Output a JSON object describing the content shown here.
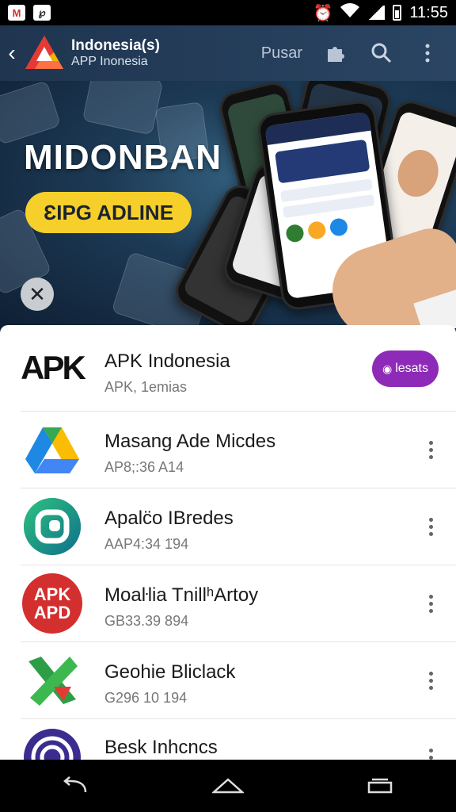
{
  "status_bar": {
    "time": "11:55",
    "left_icons": [
      "gmail-icon",
      "notification-icon"
    ],
    "right_icons": [
      "alarm-icon",
      "wifi-icon",
      "signal-icon",
      "battery-icon"
    ]
  },
  "app_bar": {
    "title": "Indonesia(s)",
    "subtitle": "APP Inonesia",
    "action_text": "Pusar",
    "icons": [
      "back-icon",
      "puzzle-icon",
      "search-icon",
      "more-vert-icon"
    ]
  },
  "banner": {
    "headline": "MIDONBAN",
    "pill_label": "ƐIPG ADLINE",
    "close_icon": "close-icon"
  },
  "featured": {
    "logo_text": "APK",
    "name": "APK Indonesia",
    "meta": "APK, 1emias",
    "button_label": "lesats",
    "button_color": "#8e2ab8"
  },
  "apps": [
    {
      "name": "Masang Ade Micdes",
      "meta": "AP8;:36 A14",
      "icon": "drive-triangle-icon"
    },
    {
      "name": "Apalc̈o IBredes",
      "meta": "AAP4:34 1̈94",
      "icon": "green-p-icon"
    },
    {
      "name": "MoaŀƖia TniƖlʰArtoy",
      "meta": "GB33.39 894",
      "icon": "apk-apd-icon",
      "icon_text": [
        "APK",
        "APD"
      ]
    },
    {
      "name": "Geohie Bliclack",
      "meta": "G296 10 194",
      "icon": "green-x-icon"
    },
    {
      "name": "Besk Inhcncs",
      "meta": "",
      "icon": "purple-target-icon"
    }
  ],
  "nav_bar": {
    "icons": [
      "back-nav-icon",
      "home-nav-icon",
      "recents-nav-icon"
    ]
  }
}
